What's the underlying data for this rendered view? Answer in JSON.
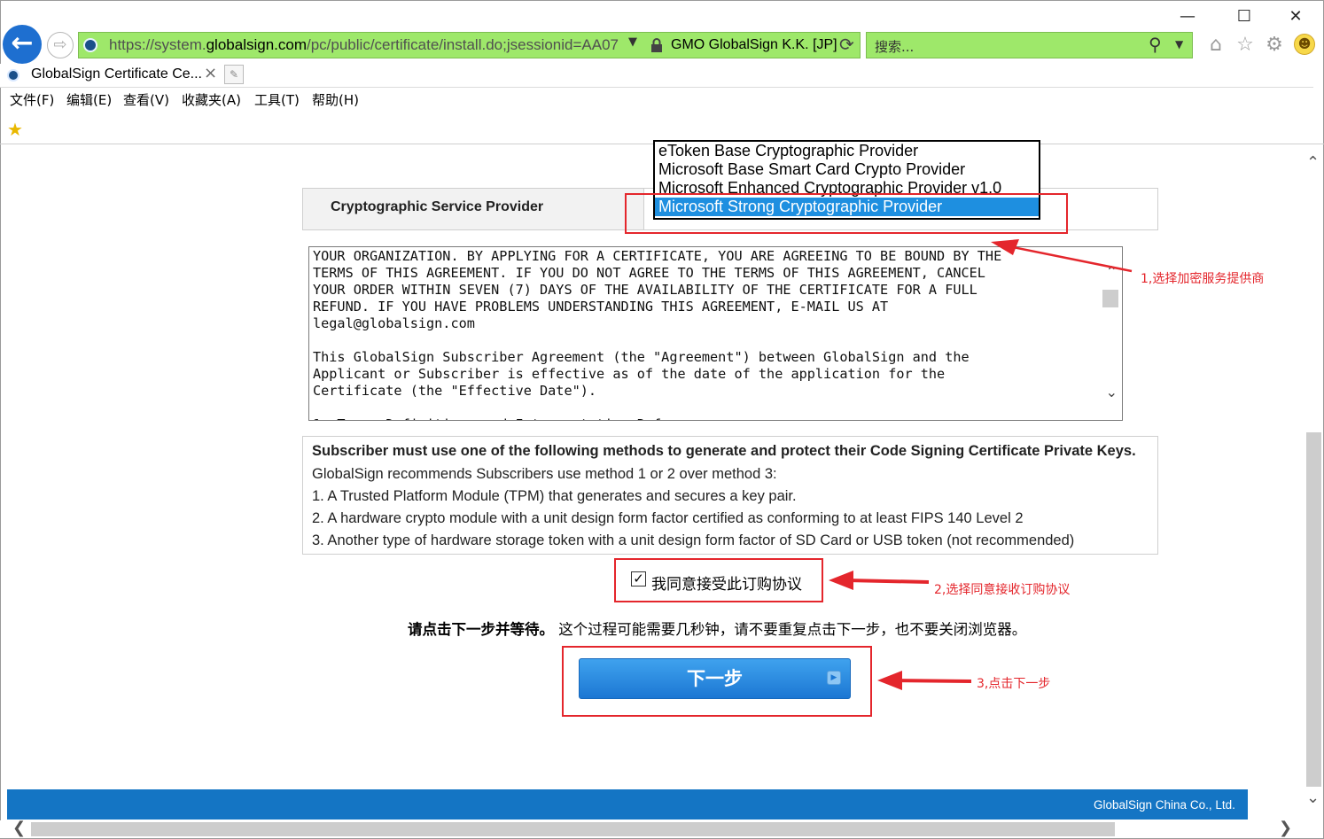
{
  "window": {
    "minimize": "—",
    "maximize": "☐",
    "close": "✕"
  },
  "address_bar": {
    "url_prefix": "https://system.",
    "url_domain": "globalsign.com",
    "url_path": "/pc/public/certificate/install.do;jsessionid=AA07",
    "cert_owner": "GMO GlobalSign K.K. [JP]"
  },
  "search_bar": {
    "placeholder": "搜索..."
  },
  "tab": {
    "title": "GlobalSign Certificate Ce...",
    "close": "×"
  },
  "menu": {
    "items": [
      "文件(F)",
      "编辑(E)",
      "查看(V)",
      "收藏夹(A)",
      "工具(T)",
      "帮助(H)"
    ]
  },
  "csp": {
    "label": "Cryptographic Service Provider",
    "options": [
      "eToken Base Cryptographic Provider",
      "Microsoft Base Smart Card Crypto Provider",
      "Microsoft Enhanced Cryptographic Provider v1.0",
      "Microsoft Strong Cryptographic Provider"
    ],
    "selected": "Microsoft Strong Cryptographic Provider"
  },
  "agreement": {
    "text": "YOUR ORGANIZATION. BY APPLYING FOR A CERTIFICATE, YOU ARE AGREEING TO BE BOUND BY THE\nTERMS OF THIS AGREEMENT. IF YOU DO NOT AGREE TO THE TERMS OF THIS AGREEMENT, CANCEL\nYOUR ORDER WITHIN SEVEN (7) DAYS OF THE AVAILABILITY OF THE CERTIFICATE FOR A FULL\nREFUND. IF YOU HAVE PROBLEMS UNDERSTANDING THIS AGREEMENT, E-MAIL US AT\nlegal@globalsign.com\n\nThis GlobalSign Subscriber Agreement (the \"Agreement\") between GlobalSign and the\nApplicant or Subscriber is effective as of the date of the application for the\nCertificate (the \"Effective Date\").\n\n1. Terms Definitions and Interpretation Ref..."
  },
  "methods": {
    "heading": "Subscriber must use one of the following methods to generate and protect their Code Signing Certificate Private Keys.",
    "lines": [
      "GlobalSign recommends Subscribers use method 1 or 2 over method 3:",
      "1. A Trusted Platform Module (TPM) that generates and secures a key pair.",
      "2. A hardware crypto module with a unit design form factor certified as conforming to at least FIPS 140 Level 2",
      "3. Another type of hardware storage token with a unit design form factor of SD Card or USB token (not recommended)"
    ]
  },
  "agree": {
    "label": "我同意接受此订购协议",
    "checked": true
  },
  "instruction": {
    "bold": "请点击下一步并等待。",
    "rest": " 这个过程可能需要几秒钟，请不要重复点击下一步，也不要关闭浏览器。"
  },
  "next_button": {
    "label": "下一步"
  },
  "annotations": {
    "a1": "1,选择加密服务提供商",
    "a2": "2,选择同意接收订购协议",
    "a3": "3,点击下一步"
  },
  "footer": {
    "text": "GlobalSign China Co., Ltd."
  },
  "colors": {
    "accent": "#1475c4",
    "annotation": "#e4262c",
    "address_bar": "#9ee86a"
  }
}
